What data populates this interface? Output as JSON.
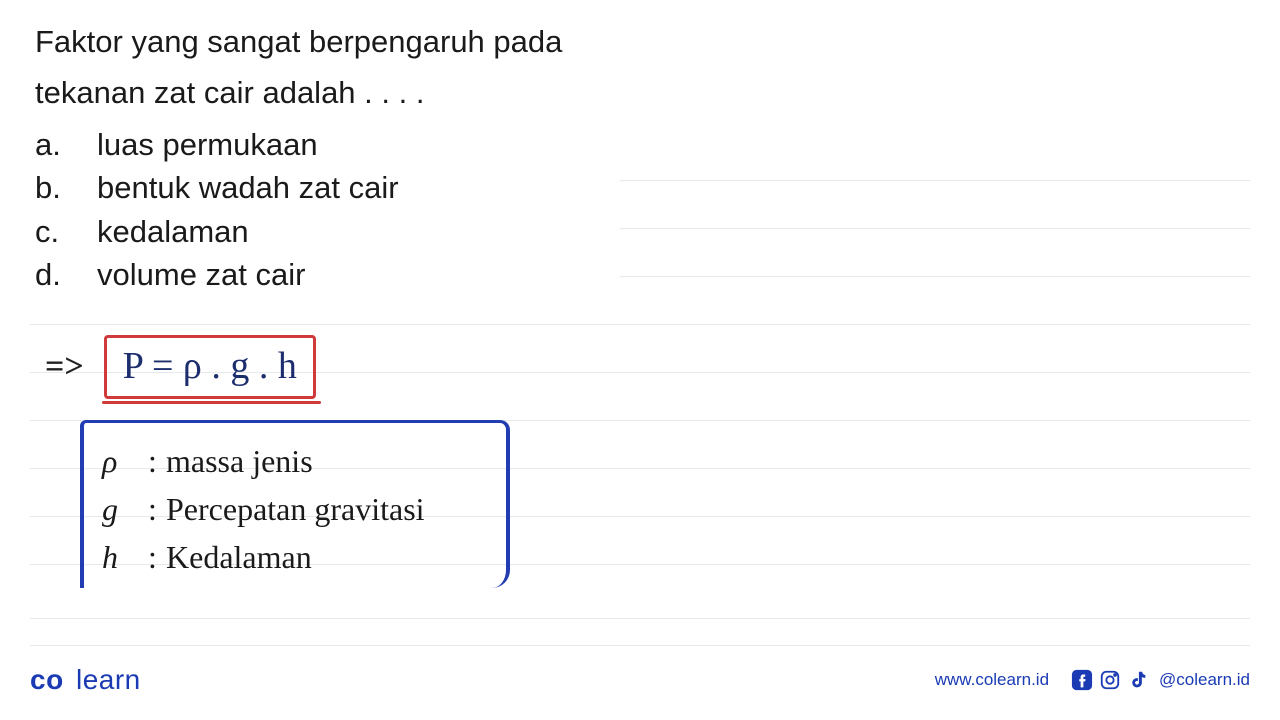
{
  "question": {
    "prompt_line1": "Faktor yang sangat berpengaruh pada",
    "prompt_line2": "tekanan zat cair adalah . . . .",
    "options": [
      {
        "letter": "a.",
        "text": "luas permukaan"
      },
      {
        "letter": "b.",
        "text": "bentuk wadah zat cair"
      },
      {
        "letter": "c.",
        "text": "kedalaman"
      },
      {
        "letter": "d.",
        "text": "volume zat cair"
      }
    ]
  },
  "formula": {
    "arrow": "=>",
    "expression": "P = ρ . g . h"
  },
  "legend": [
    {
      "symbol": "ρ",
      "label": "massa jenis"
    },
    {
      "symbol": "g",
      "label": "Percepatan gravitasi"
    },
    {
      "symbol": "h",
      "label": "Kedalaman"
    }
  ],
  "footer": {
    "logo_co": "co",
    "logo_learn": "learn",
    "url": "www.colearn.id",
    "handle": "@colearn.id"
  },
  "colors": {
    "formula_border": "#d03a3a",
    "legend_border": "#223db2",
    "brand": "#1a3bb3"
  }
}
